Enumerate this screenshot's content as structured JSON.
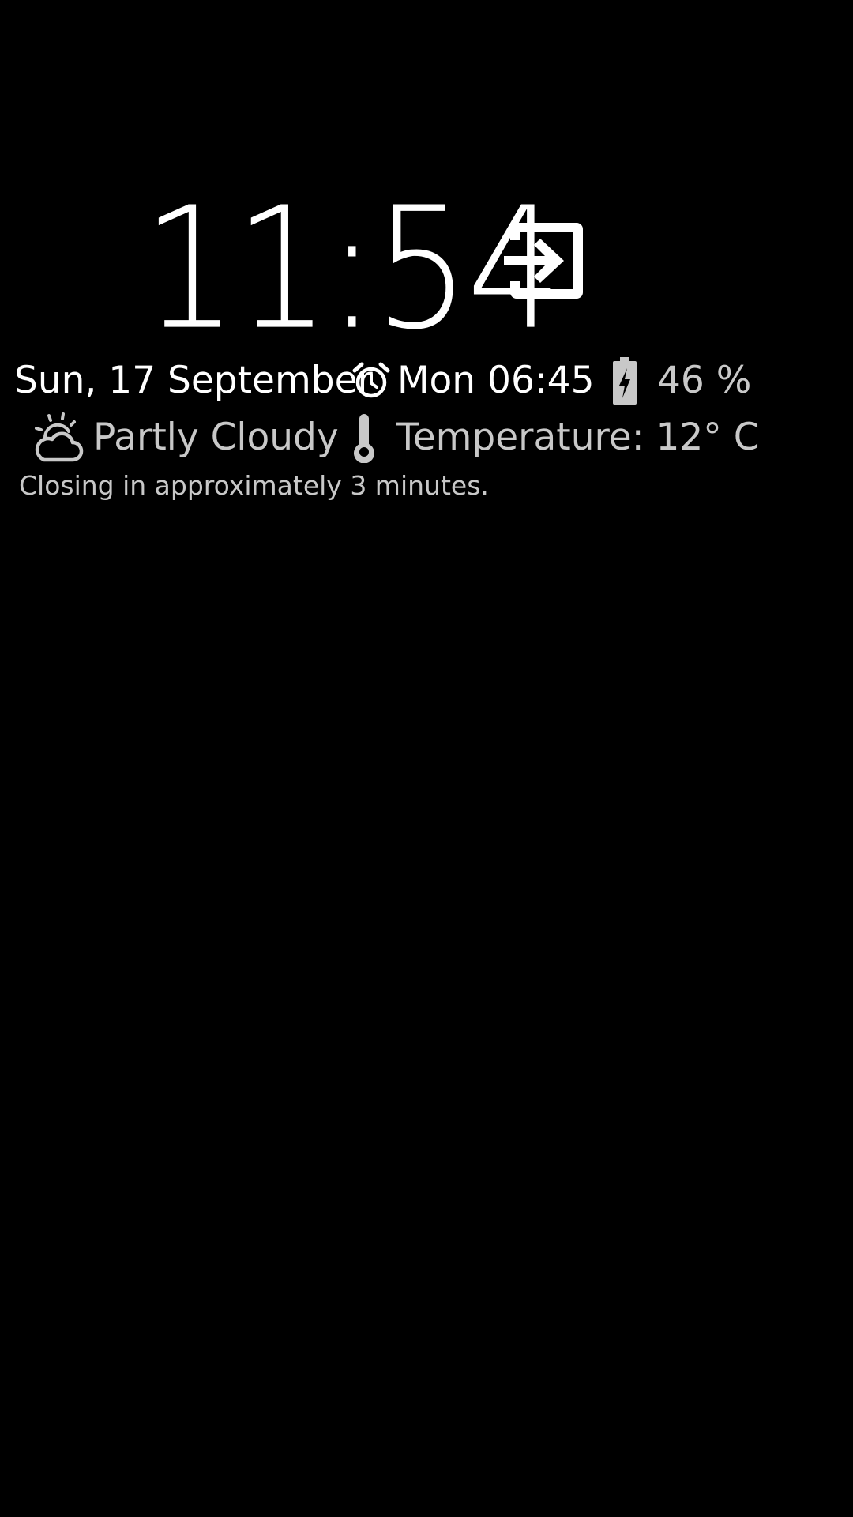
{
  "clock": {
    "time": "11:54",
    "exit_icon": "exit-to-app-icon"
  },
  "status": {
    "date": "Sun, 17 September",
    "alarm_icon": "alarm-clock-icon",
    "alarm": "Mon 06:45",
    "battery_icon": "battery-charging-icon",
    "battery": "46 %",
    "battery_level": 0.46
  },
  "weather": {
    "icon": "partly-cloudy-icon",
    "condition": "Partly Cloudy",
    "thermometer_icon": "thermometer-icon",
    "temperature": "Temperature: 12° C"
  },
  "closing_message": "Closing in approximately 3 minutes.",
  "colors": {
    "background": "#000000",
    "primary_text": "#ffffff",
    "secondary_text": "#c8c8c8"
  }
}
